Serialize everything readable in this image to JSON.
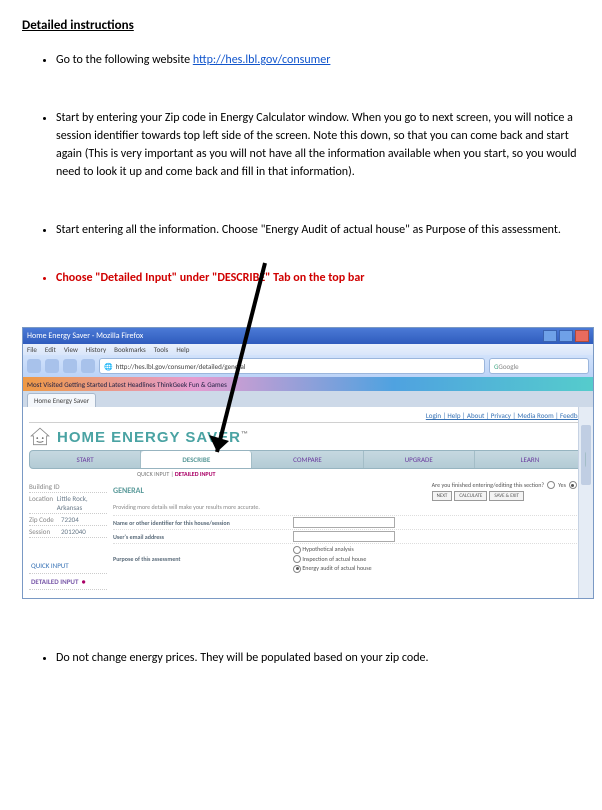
{
  "document": {
    "title": "Detailed instructions",
    "bullet1_prefix": "Go to the following website  ",
    "bullet1_link": "http://hes.lbl.gov/consumer",
    "bullet2": "Start by entering your Zip code in Energy Calculator window. When you go to next screen, you will notice a session identifier towards top left side of the screen. Note this down, so that you can come back and start again (This is very important as you will not have all the information available when you start, so you would need to look it up and come back and fill in that information).",
    "bullet3": "Start entering all the information. Choose \"Energy Audit of actual house\" as Purpose of this assessment.",
    "bullet4": "Choose \"Detailed Input\" under \"DESCRIBE\" Tab on the top bar",
    "bullet5": "Do not change energy prices. They will be populated based on your zip code."
  },
  "screenshot": {
    "windowTitle": "Home Energy Saver - Mozilla Firefox",
    "menubar": [
      "File",
      "Edit",
      "View",
      "History",
      "Bookmarks",
      "Tools",
      "Help"
    ],
    "addressUrl": "http://hes.lbl.gov/consumer/detailed/general",
    "searchPlaceholder": "Google",
    "bookmarksBar": "Most Visited   Getting Started   Latest Headlines   ThinkGeek   Fun & Games",
    "browserTab": "Home Energy Saver",
    "topLinks": "Login | Help | About | Privacy | Media Room | Feedback",
    "bannerText": "HOME ENERGY SAVER",
    "tm": "™",
    "tabs": {
      "start": "START",
      "describe": "DESCRIBE",
      "compare": "COMPARE",
      "upgrade": "UPGRADE",
      "learn": "LEARN"
    },
    "subtabs": {
      "quick": "QUICK INPUT",
      "detailed": "DETAILED INPUT"
    },
    "side": {
      "buildingLabel": "Building ID",
      "locLabel": "Location",
      "locVal": "Little Rock, Arkansas",
      "zipLabel": "Zip Code",
      "zipVal": "72204",
      "sessLabel": "Session",
      "sessVal": "2012040",
      "quick": "QUICK INPUT",
      "detailed": "DETAILED INPUT"
    },
    "general": {
      "header": "GENERAL",
      "subtitle": "Providing more details will make your results more accurate.",
      "finishedQ": "Are you finished entering/editing this section?",
      "yes": "Yes",
      "no": "No",
      "buttons": {
        "next": "NEXT",
        "calc": "CALCULATE",
        "save": "SAVE & EXIT"
      },
      "fields": {
        "name": "Name or other identifier for this house/session",
        "email": "User's email address",
        "purposeLabel": "Purpose of this assessment",
        "purposeOpts": [
          "Hypothetical analysis",
          "Inspection of actual house",
          "Energy audit of actual house"
        ]
      }
    }
  }
}
